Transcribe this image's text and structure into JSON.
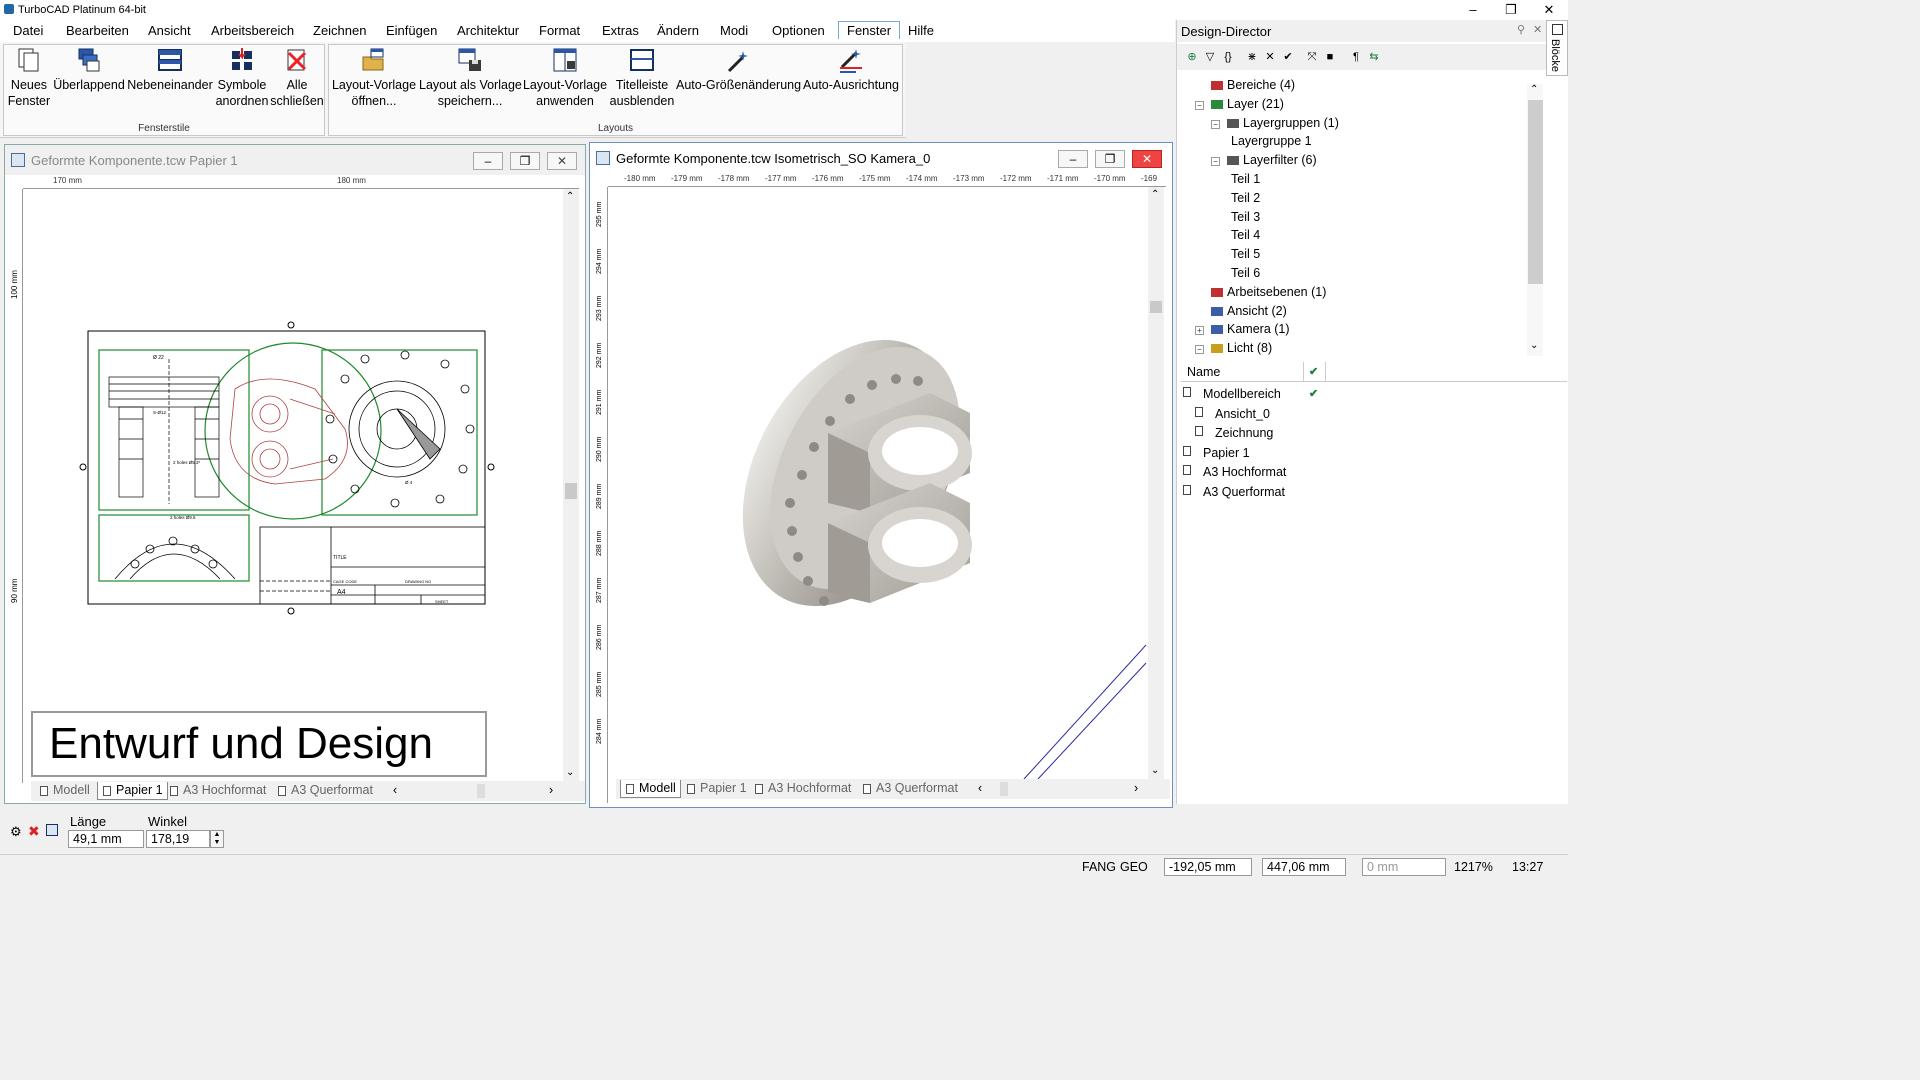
{
  "app": {
    "title": "TurboCAD  Platinum 64-bit"
  },
  "window_controls": {
    "minimize": "–",
    "maximize": "❐",
    "close": "✕"
  },
  "menu": [
    "Datei",
    "Bearbeiten",
    "Ansicht",
    "Arbeitsbereich",
    "Zeichnen",
    "Einfügen",
    "Architektur",
    "Format",
    "Extras",
    "Ändern",
    "Modi",
    "Optionen",
    "Fenster",
    "Hilfe"
  ],
  "menu_active": "Fenster",
  "ribbon": {
    "groups": [
      {
        "label": "Fensterstile",
        "buttons": [
          {
            "l1": "Neues",
            "l2": "Fenster"
          },
          {
            "l1": "Überlappend",
            "l2": ""
          },
          {
            "l1": "Nebeneinander",
            "l2": ""
          },
          {
            "l1": "Symbole",
            "l2": "anordnen"
          },
          {
            "l1": "Alle",
            "l2": "schließen"
          }
        ]
      },
      {
        "label": "Layouts",
        "buttons": [
          {
            "l1": "Layout-Vorlage",
            "l2": "öffnen..."
          },
          {
            "l1": "Layout als Vorlage",
            "l2": "speichern..."
          },
          {
            "l1": "Layout-Vorlage",
            "l2": "anwenden"
          },
          {
            "l1": "Titelleiste",
            "l2": "ausblenden"
          },
          {
            "l1": "Auto-Größenänderung",
            "l2": ""
          },
          {
            "l1": "Auto-Ausrichtung",
            "l2": ""
          }
        ]
      }
    ]
  },
  "doc_left": {
    "title": "Geformte Komponente.tcw Papier 1",
    "ruler_top": [
      "170 mm",
      "180 mm"
    ],
    "ruler_left": [
      "100 mm",
      "90 mm"
    ],
    "banner": "Entwurf und Design",
    "tabs": [
      "Modell",
      "Papier 1",
      "A3 Hochformat",
      "A3 Querformat"
    ],
    "active_tab": "Papier 1",
    "drawing": {
      "dims": [
        "Ø 22",
        "2 holes Ø9.5",
        "S-Ø12",
        "2 holes Ø5.3*",
        "Ø 4"
      ],
      "title_block": {
        "t1": "TITLE",
        "t2": "CAGE CODE",
        "t3": "DRAWING NO",
        "size": "A4",
        "sheet": "SHEET"
      }
    }
  },
  "doc_right": {
    "title": "Geformte Komponente.tcw Isometrisch_SO Kamera_0",
    "ruler_top": [
      "-180 mm",
      "-179 mm",
      "-178 mm",
      "-177 mm",
      "-176 mm",
      "-175 mm",
      "-174 mm",
      "-173 mm",
      "-172 mm",
      "-171 mm",
      "-170 mm",
      "-169"
    ],
    "ruler_left": [
      "295 mm",
      "294 mm",
      "293 mm",
      "292 mm",
      "291 mm",
      "290 mm",
      "289 mm",
      "288 mm",
      "287 mm",
      "286 mm",
      "285 mm",
      "284 mm"
    ],
    "tabs": [
      "Modell",
      "Papier 1",
      "A3 Hochformat",
      "A3 Querformat"
    ],
    "active_tab": "Modell"
  },
  "design_director": {
    "title": "Design-Director",
    "tree": [
      {
        "label": "Bereiche (4)",
        "level": 1,
        "icon": "region-icon",
        "exp": ""
      },
      {
        "label": "Layer (21)",
        "level": 1,
        "icon": "layer-icon",
        "exp": "−"
      },
      {
        "label": "Layergruppen (1)",
        "level": 2,
        "icon": "layergroup-icon",
        "exp": "−"
      },
      {
        "label": "Layergruppe 1",
        "level": 3,
        "icon": "",
        "exp": ""
      },
      {
        "label": "Layerfilter (6)",
        "level": 2,
        "icon": "layerfilter-icon",
        "exp": "−"
      },
      {
        "label": "Teil 1",
        "level": 3,
        "icon": "",
        "exp": ""
      },
      {
        "label": "Teil 2",
        "level": 3,
        "icon": "",
        "exp": ""
      },
      {
        "label": "Teil 3",
        "level": 3,
        "icon": "",
        "exp": ""
      },
      {
        "label": "Teil 4",
        "level": 3,
        "icon": "",
        "exp": ""
      },
      {
        "label": "Teil 5",
        "level": 3,
        "icon": "",
        "exp": ""
      },
      {
        "label": "Teil 6",
        "level": 3,
        "icon": "",
        "exp": ""
      },
      {
        "label": "Arbeitsebenen (1)",
        "level": 1,
        "icon": "workplane-icon",
        "exp": ""
      },
      {
        "label": "Ansicht (2)",
        "level": 1,
        "icon": "view-icon",
        "exp": ""
      },
      {
        "label": "Kamera (1)",
        "level": 1,
        "icon": "camera-icon",
        "exp": "+"
      },
      {
        "label": "Licht (8)",
        "level": 1,
        "icon": "light-icon",
        "exp": "−"
      }
    ],
    "list_header": {
      "name": "Name",
      "check": "✔"
    },
    "list": [
      {
        "label": "Modellbereich",
        "level": 0,
        "icon": "model-space-icon",
        "checked": "✔"
      },
      {
        "label": "Ansicht_0",
        "level": 1,
        "icon": "view-icon",
        "checked": ""
      },
      {
        "label": "Zeichnung",
        "level": 1,
        "icon": "view-icon",
        "checked": ""
      },
      {
        "label": "Papier 1",
        "level": 0,
        "icon": "page-icon",
        "checked": ""
      },
      {
        "label": "A3 Hochformat",
        "level": 0,
        "icon": "page-icon",
        "checked": ""
      },
      {
        "label": "A3 Querformat",
        "level": 0,
        "icon": "page-icon",
        "checked": ""
      }
    ]
  },
  "side_tab": "Blöcke",
  "inspector": {
    "length_label": "Länge",
    "length_value": "49,1 mm",
    "angle_label": "Winkel",
    "angle_value": "178,19"
  },
  "status": {
    "fang": "FANG",
    "geo": "GEO",
    "x": "-192,05 mm",
    "y": "447,06 mm",
    "z": "0 mm",
    "zoom": "1217%",
    "time": "13:27"
  },
  "colors": {
    "accent": "#7aa7d8",
    "drawing_green": "#1f8a2d",
    "drawing_red": "#b04040",
    "model_gray": "#bfbcb7"
  }
}
